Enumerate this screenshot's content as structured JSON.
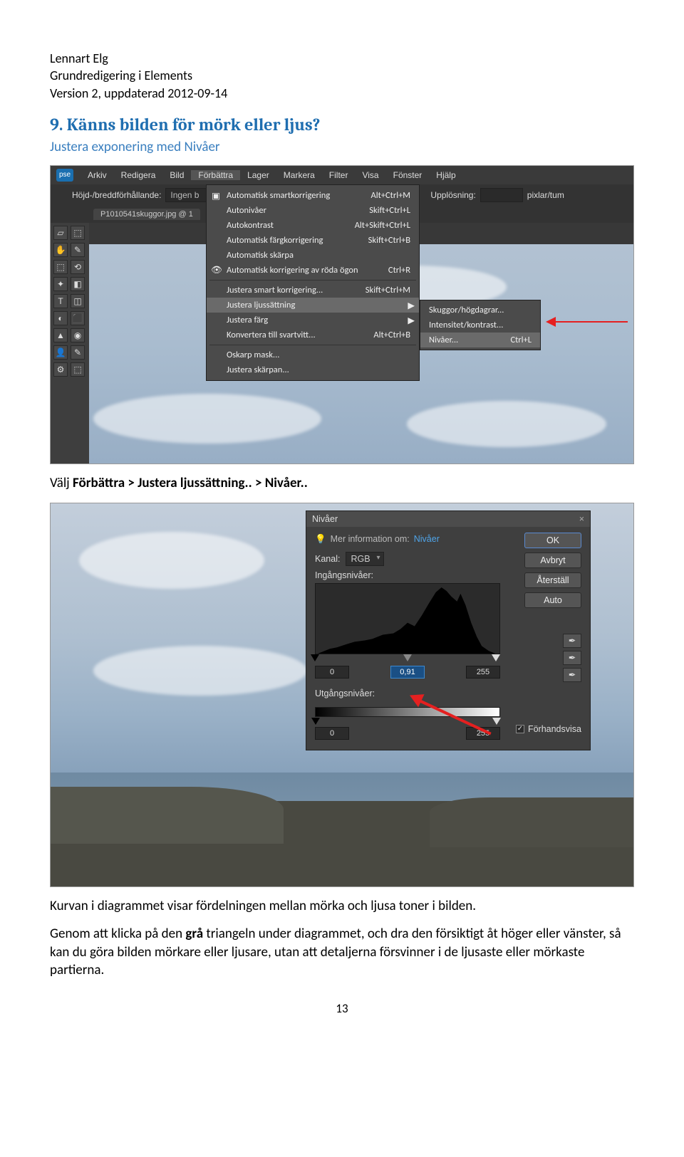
{
  "doc": {
    "author": "Lennart Elg",
    "title": "Grundredigering  i Elements",
    "version": "Version 2, uppdaterad 2012-09-14",
    "section_title": "9.  Känns bilden för mörk eller ljus?",
    "subtitle": "Justera exponering med Nivåer",
    "instruction1_pre": "Välj ",
    "instruction1_bold": "Förbättra > Justera ljussättning.. > Nivåer..",
    "para2a": "Kurvan i diagrammet visar fördelningen mellan mörka och ljusa toner i bilden.",
    "para2b_pre": "Genom att klicka på den ",
    "para2b_bold": "grå",
    "para2b_post": " triangeln under diagrammet, och dra den försiktigt åt höger eller vänster, så kan du göra bilden mörkare eller ljusare, utan att detaljerna försvinner i de ljusaste eller mörkaste partierna.",
    "page_number": "13"
  },
  "app": {
    "badge": "pse",
    "menus": [
      "Arkiv",
      "Redigera",
      "Bild",
      "Förbättra",
      "Lager",
      "Markera",
      "Filter",
      "Visa",
      "Fönster",
      "Hjälp"
    ],
    "ratio_label": "Höjd-/breddförhållande:",
    "ratio_value": "Ingen b",
    "resolution_label": "Upplösning:",
    "resolution_unit": "pixlar/tum",
    "file_tab": "P1010541skuggor.jpg @ 1",
    "dropdown": [
      {
        "label": "Automatisk smartkorrigering",
        "shortcut": "Alt+Ctrl+M",
        "icon": "▣"
      },
      {
        "label": "Autonivåer",
        "shortcut": "Skift+Ctrl+L"
      },
      {
        "label": "Autokontrast",
        "shortcut": "Alt+Skift+Ctrl+L"
      },
      {
        "label": "Automatisk färgkorrigering",
        "shortcut": "Skift+Ctrl+B"
      },
      {
        "label": "Automatisk skärpa",
        "shortcut": ""
      },
      {
        "label": "Automatisk korrigering av röda ögon",
        "shortcut": "Ctrl+R",
        "icon": "👁"
      }
    ],
    "dropdown2": [
      {
        "label": "Justera smart korrigering...",
        "shortcut": "Skift+Ctrl+M"
      },
      {
        "label": "Justera ljussättning",
        "shortcut": "",
        "arrow": "▶",
        "hover": true
      },
      {
        "label": "Justera färg",
        "shortcut": "",
        "arrow": "▶"
      },
      {
        "label": "Konvertera till svartvitt...",
        "shortcut": "Alt+Ctrl+B"
      }
    ],
    "dropdown3": [
      {
        "label": "Oskarp mask..."
      },
      {
        "label": "Justera skärpan..."
      }
    ],
    "submenu": [
      {
        "label": "Skuggor/högdagrar..."
      },
      {
        "label": "Intensitet/kontrast..."
      },
      {
        "label": "Nivåer...",
        "shortcut": "Ctrl+L",
        "hover": true
      }
    ],
    "tools": [
      "▱",
      "⬚",
      "✋",
      "✎",
      "⬚",
      "⟲",
      "✦",
      "◧",
      "T",
      "◫",
      "◐",
      "⬛",
      "▲",
      "◉",
      "👤",
      "✎",
      "⚙",
      "⬚"
    ]
  },
  "levels": {
    "title": "Nivåer",
    "close": "×",
    "info_label": "Mer information om:",
    "info_link": "Nivåer",
    "ok": "OK",
    "cancel": "Avbryt",
    "reset": "Återställ",
    "auto": "Auto",
    "channel_label": "Kanal:",
    "channel_value": "RGB",
    "input_label": "Ingångsnivåer:",
    "black": "0",
    "gamma": "0,91",
    "white": "255",
    "output_label": "Utgångsnivåer:",
    "out_black": "0",
    "out_white": "255",
    "preview": "Förhandsvisa",
    "bulb": "💡"
  }
}
